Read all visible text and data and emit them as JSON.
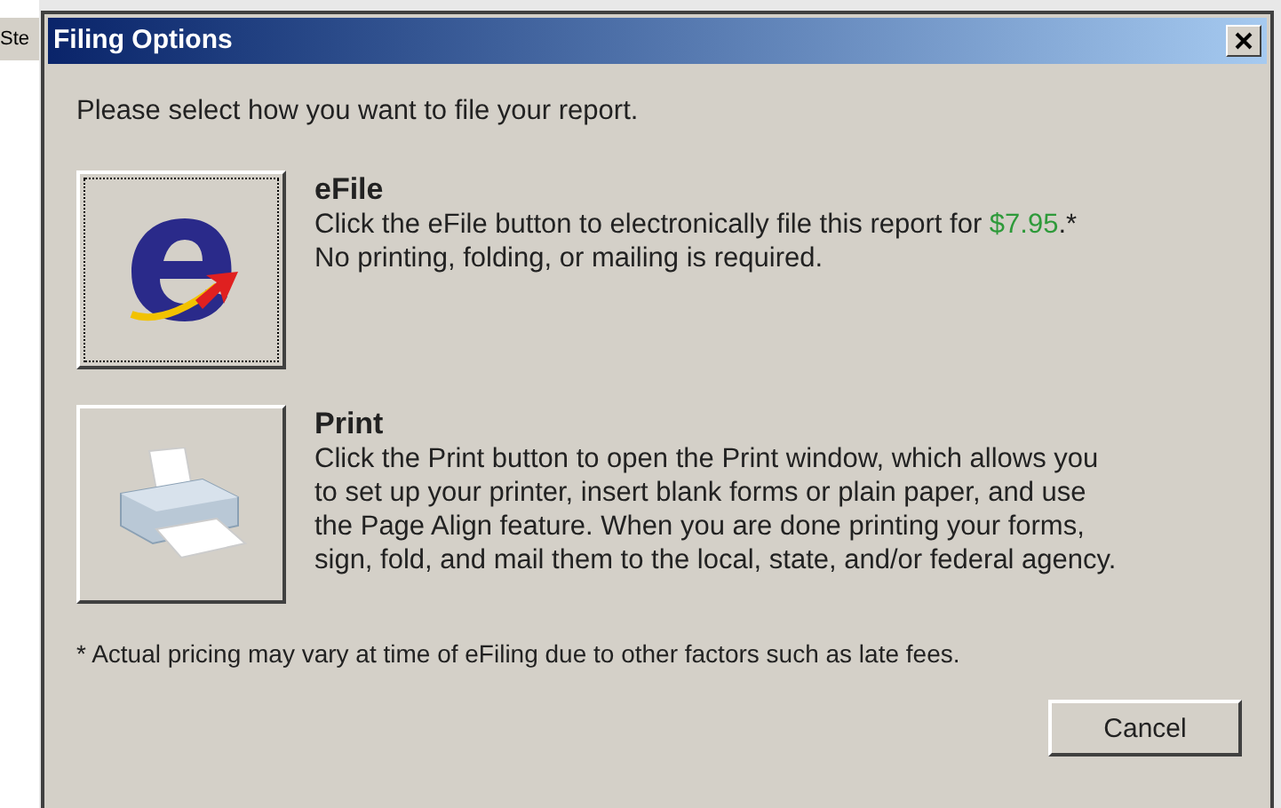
{
  "background": {
    "button_text": "Ste"
  },
  "window": {
    "title": "Filing Options"
  },
  "prompt": "Please select how you want to file your report.",
  "options": [
    {
      "kind": "efile",
      "title": "eFile",
      "focused": true,
      "description": "Click the eFile button to electronically file this report for **$7.95**.*\nNo printing, folding, or mailing is required."
    },
    {
      "kind": "print",
      "title": "Print",
      "focused": false,
      "description": "Click the Print button to open the Print window, which allows you\nto set up your printer, insert blank forms or plain paper, and use\nthe Page Align feature. When you are done printing your forms,\nsign, fold, and mail them to the local, state, and/or federal agency."
    }
  ],
  "footnote": "* Actual pricing may vary at time of eFiling due to other factors such as late fees.",
  "buttons": [
    "Cancel"
  ]
}
